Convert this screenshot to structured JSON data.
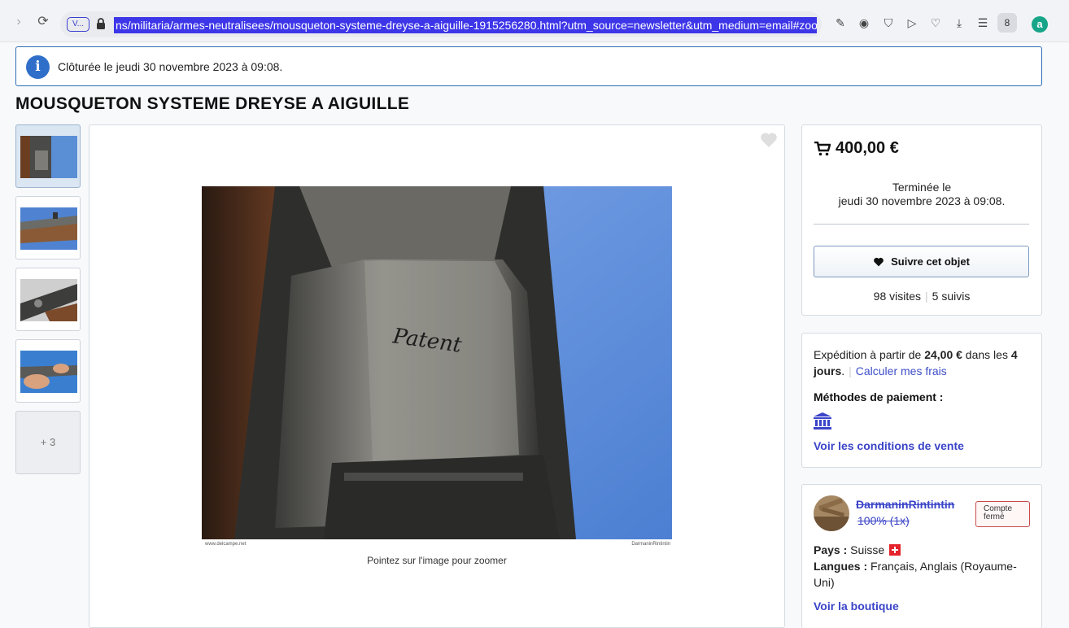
{
  "browser": {
    "site_badge": "V...",
    "url": "ns/militaria/armes-neutralisees/mousqueton-systeme-dreyse-a-aiguille-1915256280.html?utm_source=newsletter&utm_medium=email#zoom",
    "profile_glyph": "8",
    "extension_glyph": "a"
  },
  "notice": {
    "text": "Clôturée le jeudi 30 novembre 2023 à 09:08."
  },
  "item": {
    "title": "MOUSQUETON SYSTEME DREYSE A AIGUILLE"
  },
  "gallery": {
    "more_label": "+ 3",
    "photo_caption_left": "www.delcampe.net",
    "photo_caption_right": "DarmaninRintintin",
    "photo_engraving": "Patent",
    "zoom_hint": "Pointez sur l'image pour zoomer"
  },
  "pricing": {
    "price": "400,00 €",
    "ended_label": "Terminée le",
    "ended_date": "jeudi 30 novembre 2023 à 09:08.",
    "follow_label": "Suivre cet objet",
    "visits": "98 visites",
    "followers": "5 suivis"
  },
  "shipping": {
    "prefix": "Expédition à partir de ",
    "amount": "24,00 €",
    "middle": " dans les ",
    "days": "4 jours",
    "suffix": ".",
    "calc_link": "Calculer mes frais",
    "payment_title": "Méthodes de paiement :",
    "conditions_link": "Voir les conditions de vente"
  },
  "seller": {
    "name": "DarmaninRintintin",
    "rating": "100% (1x)",
    "status_badge": "Compte fermé",
    "country_label": "Pays :",
    "country": "Suisse",
    "languages_label": "Langues :",
    "languages": "Français, Anglais (Royaume-Uni)",
    "shop_link": "Voir la boutique"
  },
  "colors": {
    "accent": "#3a44c8",
    "info": "#2f6fc9",
    "url_highlight": "#3d36e8"
  }
}
